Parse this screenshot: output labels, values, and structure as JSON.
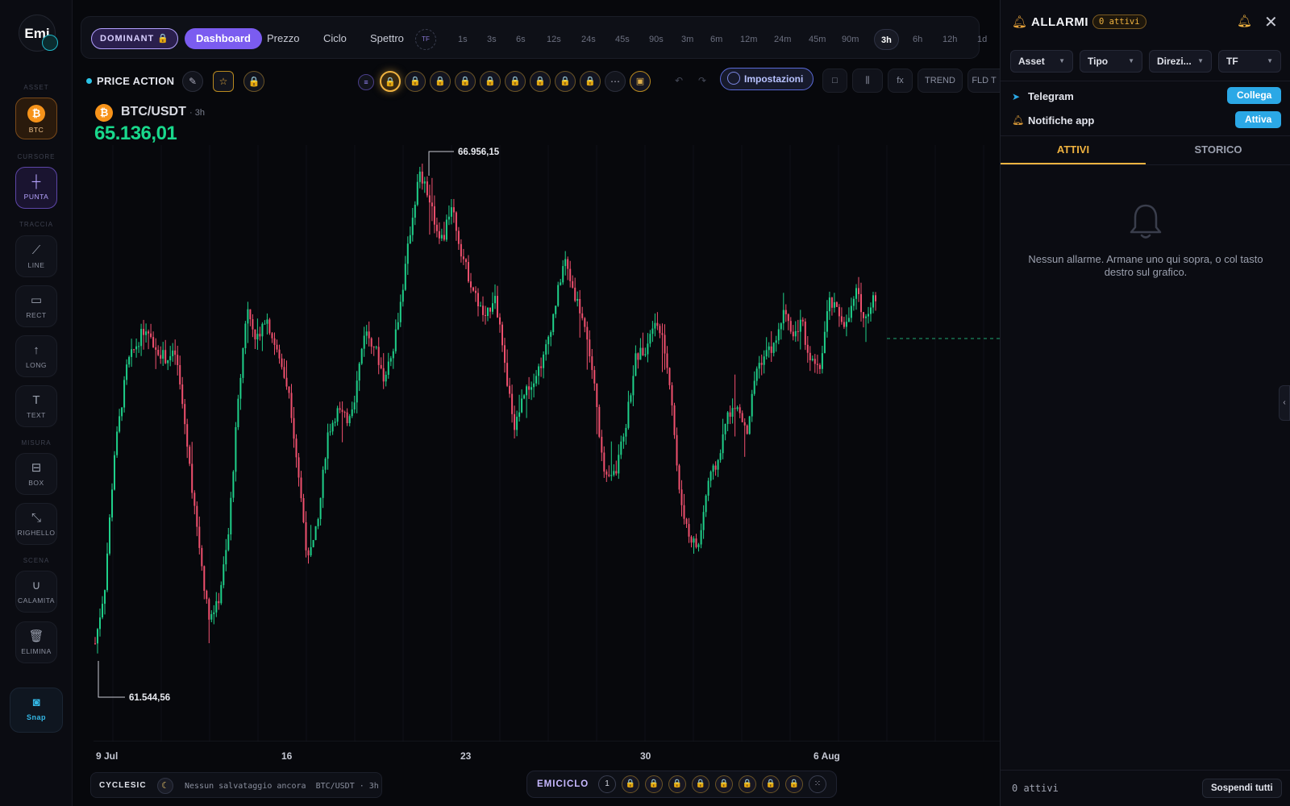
{
  "rail": {
    "logo": "Emi",
    "sections": {
      "asset": "ASSET",
      "cursore": "CURSORE",
      "traccia": "TRACCIA",
      "misura": "MISURA",
      "scena": "SCENA"
    },
    "tools": {
      "btc": "BTC",
      "punta": "PUNTA",
      "line": "LINE",
      "rect": "RECT",
      "long": "LONG",
      "text": "TEXT",
      "box": "BOX",
      "righello": "RIGHELLO",
      "calamita": "CALAMITA",
      "elimina": "ELIMINA",
      "snap": "Snap"
    }
  },
  "topnav": {
    "dominant": "DOMINANT",
    "tabs": [
      "Dashboard",
      "Prezzo",
      "Ciclo",
      "Spettro"
    ],
    "active_tab": "Dashboard",
    "tf_badge": "TF",
    "timeframes": [
      "1s",
      "3s",
      "6s",
      "12s",
      "24s",
      "45s",
      "90s",
      "3m",
      "6m",
      "12m",
      "24m",
      "45m",
      "90m",
      "3h",
      "6h",
      "12h",
      "1d"
    ],
    "active_timeframe": "3h"
  },
  "toolbar": {
    "section_label": "PRICE ACTION",
    "settings_label": "Impostazioni",
    "fx": "fx",
    "trend": "TREND",
    "fld": "FLD T"
  },
  "symbol": {
    "pair": "BTC/USDT",
    "timeframe": "· 3h",
    "price": "65.136,01"
  },
  "chart_data": {
    "type": "candlestick",
    "high_label": "66.956,15",
    "low_label": "61.544,56",
    "x_ticks": [
      "9 Jul",
      "16",
      "23",
      "30",
      "6 Aug"
    ],
    "last_price_line": "dashed green",
    "up_color": "#1fd08a",
    "down_color": "#f0506e",
    "points": [
      [
        0,
        61900
      ],
      [
        12,
        62500
      ],
      [
        24,
        63900
      ],
      [
        40,
        64850
      ],
      [
        60,
        65200
      ],
      [
        72,
        65050
      ],
      [
        88,
        64900
      ],
      [
        100,
        64950
      ],
      [
        110,
        64300
      ],
      [
        125,
        63200
      ],
      [
        140,
        62200
      ],
      [
        152,
        62300
      ],
      [
        165,
        63000
      ],
      [
        175,
        64200
      ],
      [
        188,
        65450
      ],
      [
        200,
        65100
      ],
      [
        212,
        65350
      ],
      [
        226,
        64950
      ],
      [
        240,
        64600
      ],
      [
        252,
        63700
      ],
      [
        264,
        62750
      ],
      [
        276,
        63150
      ],
      [
        288,
        64100
      ],
      [
        300,
        64350
      ],
      [
        312,
        64250
      ],
      [
        322,
        64500
      ],
      [
        334,
        65200
      ],
      [
        346,
        65050
      ],
      [
        358,
        64700
      ],
      [
        370,
        65050
      ],
      [
        380,
        65550
      ],
      [
        390,
        66200
      ],
      [
        402,
        66850
      ],
      [
        412,
        66650
      ],
      [
        422,
        66300
      ],
      [
        432,
        66150
      ],
      [
        442,
        66550
      ],
      [
        452,
        66100
      ],
      [
        462,
        65800
      ],
      [
        472,
        65550
      ],
      [
        484,
        65300
      ],
      [
        496,
        65600
      ],
      [
        508,
        64800
      ],
      [
        520,
        64200
      ],
      [
        532,
        64500
      ],
      [
        544,
        64700
      ],
      [
        556,
        64900
      ],
      [
        568,
        65350
      ],
      [
        582,
        65950
      ],
      [
        594,
        65600
      ],
      [
        606,
        65300
      ],
      [
        618,
        64700
      ],
      [
        632,
        63600
      ],
      [
        646,
        63700
      ],
      [
        658,
        64200
      ],
      [
        670,
        64900
      ],
      [
        682,
        65000
      ],
      [
        694,
        65350
      ],
      [
        704,
        65100
      ],
      [
        714,
        64600
      ],
      [
        724,
        63500
      ],
      [
        736,
        63050
      ],
      [
        748,
        62900
      ],
      [
        760,
        63600
      ],
      [
        772,
        63800
      ],
      [
        784,
        64300
      ],
      [
        796,
        64400
      ],
      [
        808,
        64100
      ],
      [
        820,
        64800
      ],
      [
        832,
        64950
      ],
      [
        844,
        65050
      ],
      [
        856,
        65450
      ],
      [
        866,
        65150
      ],
      [
        876,
        65300
      ],
      [
        886,
        64900
      ],
      [
        898,
        64750
      ],
      [
        910,
        65500
      ],
      [
        920,
        65400
      ],
      [
        932,
        65250
      ],
      [
        944,
        65600
      ],
      [
        954,
        65350
      ],
      [
        966,
        65520
      ]
    ]
  },
  "bottom": {
    "cyclesic": "CYCLESIC",
    "save_status": "Nessun salvataggio ancora",
    "save_symbol": "BTC/USDT · 3h",
    "emiciclo": "EMICICLO",
    "emiciclo_num": "1"
  },
  "panel": {
    "title": "ALLARMI",
    "badge": "0 attivi",
    "filters": [
      "Asset",
      "Tipo",
      "Direzi...",
      "TF"
    ],
    "telegram_label": "Telegram",
    "telegram_btn": "Collega",
    "app_label": "Notifiche app",
    "app_btn": "Attiva",
    "tab_active": "ATTIVI",
    "tab_history": "STORICO",
    "empty_msg": "Nessun allarme. Armane uno qui sopra, o col tasto destro sul grafico.",
    "footer_count": "0 attivi",
    "suspend_btn": "Sospendi tutti"
  }
}
